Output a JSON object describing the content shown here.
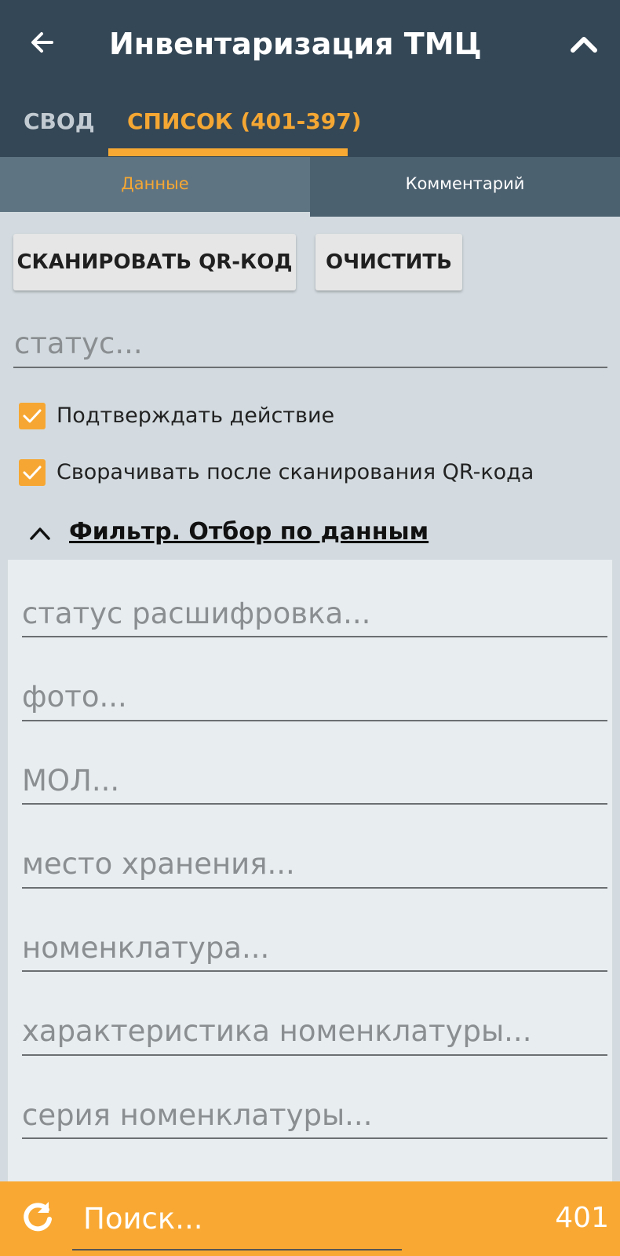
{
  "appbar": {
    "title": "Инвентаризация ТМЦ",
    "back_icon": "arrow-left-icon",
    "collapse_icon": "chevron-up-icon"
  },
  "tabs": [
    {
      "label": "СВОД"
    },
    {
      "label": "СПИСОК (401-397)",
      "active": true
    }
  ],
  "subtabs": [
    {
      "label": "Данные",
      "active": true
    },
    {
      "label": "Комментарий"
    }
  ],
  "actions": {
    "scan_label": "СКАНИРОВАТЬ QR-КОД",
    "clear_label": "ОЧИСТИТЬ"
  },
  "status_field": {
    "placeholder": "статус..."
  },
  "checkboxes": [
    {
      "label": "Подтверждать действие",
      "checked": true
    },
    {
      "label": "Сворачивать после сканирования QR-кода",
      "checked": true
    }
  ],
  "filter": {
    "title": "Фильтр. Отбор по данным",
    "fields": [
      "статус расшифровка...",
      "фото...",
      "МОЛ...",
      "место хранения...",
      "номенклатура...",
      "характеристика номенклатуры...",
      "серия номенклатуры..."
    ]
  },
  "bottom": {
    "search_placeholder": "Поиск...",
    "count": "401",
    "refresh_icon": "refresh-icon"
  },
  "colors": {
    "appbar": "#344756",
    "accent": "#f7a933",
    "background": "#d3dbe0",
    "panel": "#e8edef"
  }
}
